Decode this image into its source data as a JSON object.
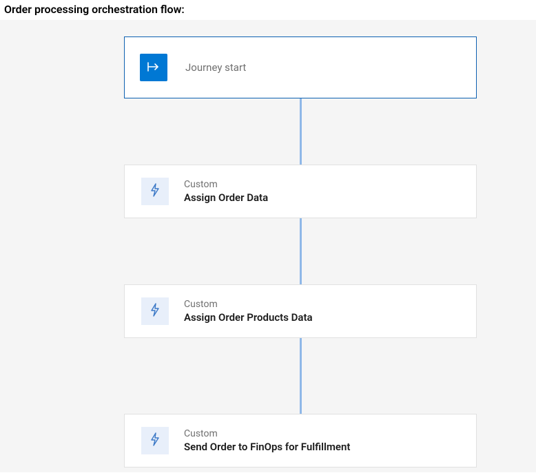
{
  "page": {
    "title": "Order processing orchestration flow:"
  },
  "flow": {
    "start": {
      "label": "Journey start"
    },
    "steps": [
      {
        "type": "Custom",
        "title": "Assign Order Data"
      },
      {
        "type": "Custom",
        "title": "Assign Order Products Data"
      },
      {
        "type": "Custom",
        "title": "Send Order to FinOps for Fulfillment"
      }
    ]
  },
  "colors": {
    "accent": "#0078d4",
    "accentBorder": "#0b5fb0",
    "connector": "#8fb8e8",
    "canvas": "#f5f5f5",
    "stepIconBg": "#e8effa"
  }
}
